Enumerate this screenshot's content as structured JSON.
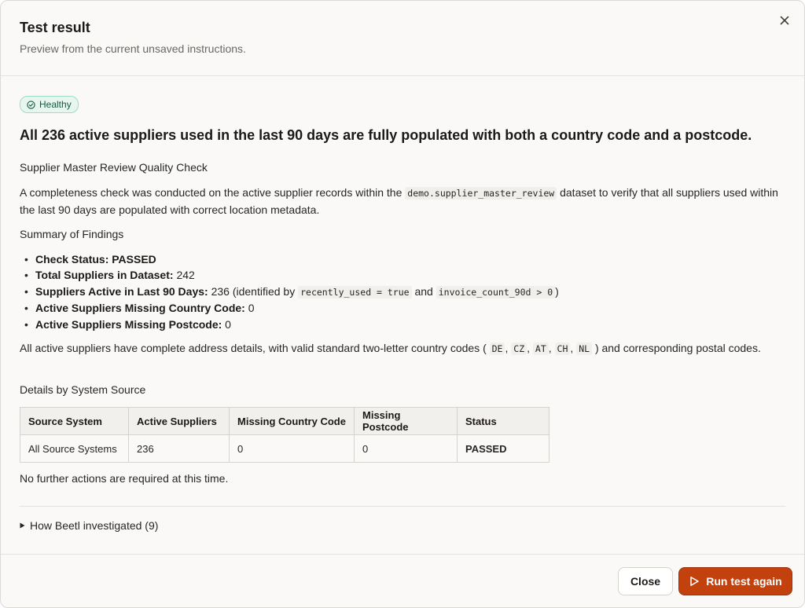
{
  "dialog": {
    "title": "Test result",
    "subtitle": "Preview from the current unsaved instructions."
  },
  "status_badge": {
    "label": "Healthy",
    "color": "#0f5b41"
  },
  "headline": "All 236 active suppliers used in the last 90 days are fully populated with both a country code and a postcode.",
  "report": {
    "heading": "Supplier Master Review Quality Check",
    "intro_before": "A completeness check was conducted on the active supplier records within the ",
    "intro_code": "demo.supplier_master_review",
    "intro_after": " dataset to verify that all suppliers used within the last 90 days are populated with correct location metadata.",
    "summary_heading": "Summary of Findings",
    "findings": [
      {
        "label": "Check Status:",
        "value": "PASSED"
      },
      {
        "label": "Total Suppliers in Dataset:",
        "value": "242"
      },
      {
        "label": "Suppliers Active in Last 90 Days:",
        "value": "236 (identified by",
        "code1": "recently_used = true",
        "mid": "and",
        "code2": "invoice_count_90d > 0",
        "end": ")"
      },
      {
        "label": "Active Suppliers Missing Country Code:",
        "value": "0"
      },
      {
        "label": "Active Suppliers Missing Postcode:",
        "value": "0"
      }
    ],
    "address_text_before": "All active suppliers have complete address details, with valid standard two-letter country codes (",
    "country_codes": [
      "DE",
      "CZ",
      "AT",
      "CH",
      "NL"
    ],
    "address_text_after": ") and corresponding postal codes.",
    "details_heading": "Details by System Source",
    "table": {
      "headers": [
        "Source System",
        "Active Suppliers",
        "Missing Country Code",
        "Missing Postcode",
        "Status"
      ],
      "rows": [
        [
          "All Source Systems",
          "236",
          "0",
          "0",
          "PASSED"
        ]
      ]
    },
    "closing": "No further actions are required at this time."
  },
  "investigation": {
    "label": "How Beetl investigated (9)"
  },
  "footer": {
    "close_label": "Close",
    "run_label": "Run test again",
    "accent": "#c2410c"
  }
}
